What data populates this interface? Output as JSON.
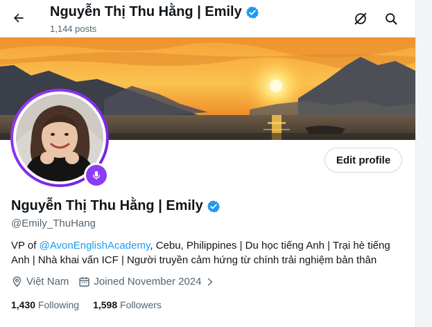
{
  "header": {
    "name": "Nguyễn Thị Thu Hằng | Emily",
    "posts": "1,144 posts",
    "icons": [
      "back-arrow-icon",
      "grok-slash-icon",
      "search-icon"
    ]
  },
  "profile": {
    "edit_label": "Edit profile",
    "name": "Nguyễn Thị Thu Hằng | Emily",
    "handle": "@Emily_ThuHang",
    "bio_prefix": "VP of ",
    "bio_mention": "@AvonEnglishAcademy",
    "bio_suffix": ", Cebu, Philippines | Du học tiếng Anh | Trại hè tiếng Anh | Nhà khai vấn ICF | Người truyền cảm hứng từ chính trải nghiệm bản thân",
    "location": "Việt Nam",
    "joined": "Joined November 2024",
    "following_count": "1,430",
    "following_label": "Following",
    "followers_count": "1,598",
    "followers_label": "Followers"
  },
  "colors": {
    "accent": "#1d9bf0",
    "verified": "#1d9bf0",
    "avatar_ring": "#8b3cf0",
    "muted_text": "#536471"
  }
}
